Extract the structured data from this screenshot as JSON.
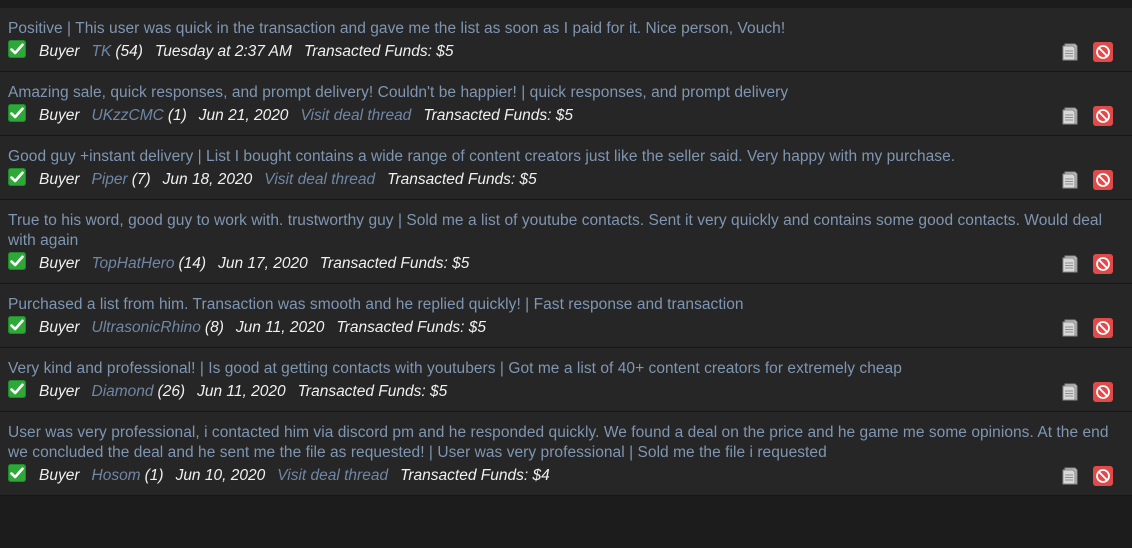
{
  "feedback": [
    {
      "comment": "Positive | This user was quick in the transaction and gave me the list as soon as I paid for it. Nice person, Vouch!",
      "role": "Buyer",
      "user": "TK",
      "count": "(54)",
      "date": "Tuesday at 2:37 AM",
      "deal_link": "",
      "funds": "Transacted Funds: $5"
    },
    {
      "comment": "Amazing sale, quick responses, and prompt delivery! Couldn't be happier! | quick responses, and prompt delivery",
      "role": "Buyer",
      "user": "UKzzCMC",
      "count": "(1)",
      "date": "Jun 21, 2020",
      "deal_link": "Visit deal thread",
      "funds": "Transacted Funds: $5"
    },
    {
      "comment": "Good guy +instant delivery | List I bought contains a wide range of content creators just like the seller said. Very happy with my purchase.",
      "role": "Buyer",
      "user": "Piper",
      "count": "(7)",
      "date": "Jun 18, 2020",
      "deal_link": "Visit deal thread",
      "funds": "Transacted Funds: $5"
    },
    {
      "comment": "True to his word, good guy to work with. trustworthy guy | Sold me a list of youtube contacts. Sent it very quickly and contains some good contacts. Would deal with again",
      "role": "Buyer",
      "user": "TopHatHero",
      "count": "(14)",
      "date": "Jun 17, 2020",
      "deal_link": "",
      "funds": "Transacted Funds: $5"
    },
    {
      "comment": "Purchased a list from him. Transaction was smooth and he replied quickly! | Fast response and transaction",
      "role": "Buyer",
      "user": "UltrasonicRhino",
      "count": "(8)",
      "date": "Jun 11, 2020",
      "deal_link": "",
      "funds": "Transacted Funds: $5"
    },
    {
      "comment": "Very kind and professional! | Is good at getting contacts with youtubers | Got me a list of 40+ content creators for extremely cheap",
      "role": "Buyer",
      "user": "Diamond",
      "count": "(26)",
      "date": "Jun 11, 2020",
      "deal_link": "",
      "funds": "Transacted Funds: $5"
    },
    {
      "comment": "User was very professional, i contacted him via discord pm and he responded quickly. We found a deal on the price and he game me some opinions. At the end we concluded the deal and he sent me the file as requested! | User was very professional | Sold me the file i requested",
      "role": "Buyer",
      "user": "Hosom",
      "count": "(1)",
      "date": "Jun 10, 2020",
      "deal_link": "Visit deal thread",
      "funds": "Transacted Funds: $4"
    }
  ],
  "icons": {
    "status": "check-icon",
    "note": "note-icon",
    "report": "block-icon"
  },
  "colors": {
    "positive": "#2fa83a",
    "link": "#6f87a6",
    "comment": "#7f96b3",
    "report": "#e24a4a"
  }
}
